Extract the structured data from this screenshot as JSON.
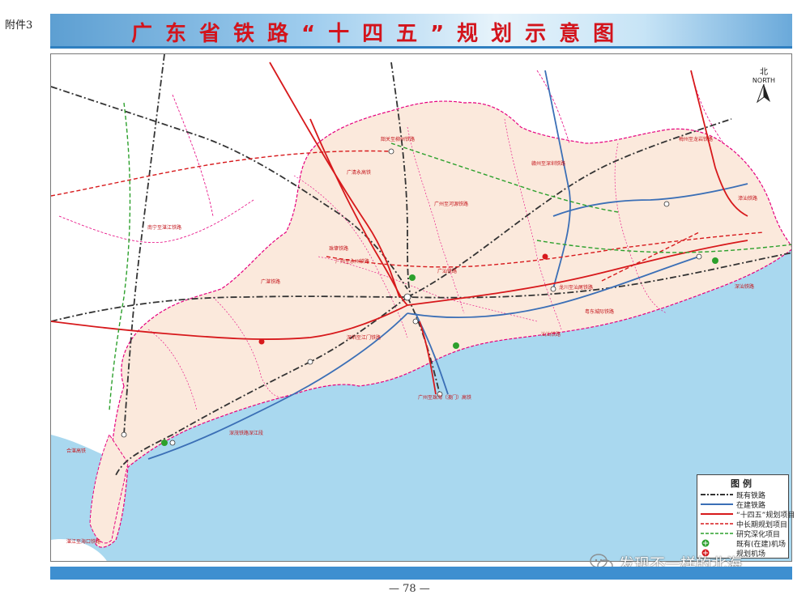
{
  "header": {
    "attachment": "附件3",
    "title": "广东省铁路“十四五”规划示意图"
  },
  "north": {
    "cn": "北",
    "en": "NORTH"
  },
  "legend": {
    "title": "图例",
    "items": [
      {
        "label": "既有铁路",
        "style": "existing",
        "color": "#333333"
      },
      {
        "label": "在建铁路",
        "style": "construction",
        "color": "#3b6fb6"
      },
      {
        "label": "“十四五”规划项目",
        "style": "plan14",
        "color": "#d7191c"
      },
      {
        "label": "中长期规划项目",
        "style": "longterm",
        "color": "#d7191c"
      },
      {
        "label": "研究深化项目",
        "style": "research",
        "color": "#2ca02c"
      },
      {
        "label": "既有(在建)机场",
        "style": "airport",
        "color": "#2ca02c"
      },
      {
        "label": "规划机场",
        "style": "planned-airport",
        "color": "#d7191c"
      }
    ]
  },
  "map": {
    "colors": {
      "sea": "#a9d8ef",
      "guangdong": "#fbe9dc",
      "neighbor": "#ffffff",
      "boundary": "#e6007e",
      "existing": "#333333",
      "construction": "#3b6fb6",
      "plan14": "#d7191c",
      "research": "#2ca02c"
    },
    "labels": [
      "韶关至柳州铁路",
      "广清永高铁",
      "广州至河源铁路",
      "赣州至深圳铁路",
      "梅州至龙岩铁路",
      "南宁至湛江铁路",
      "深圳至江门铁路",
      "广湛铁路",
      "深汕铁路",
      "汕汕铁路",
      "珠肇铁路",
      "广州至珠海（澳门）高铁",
      "深茂铁路深江段",
      "湛江至海口铁路",
      "合湛高铁",
      "广州至永州铁路",
      "粤东城际铁路",
      "漳汕铁路",
      "龙川至汕尾铁路",
      "广汕铁路"
    ]
  },
  "footer": {
    "page_number": "— 78 —",
    "watermark": "发现不一样的北海"
  }
}
